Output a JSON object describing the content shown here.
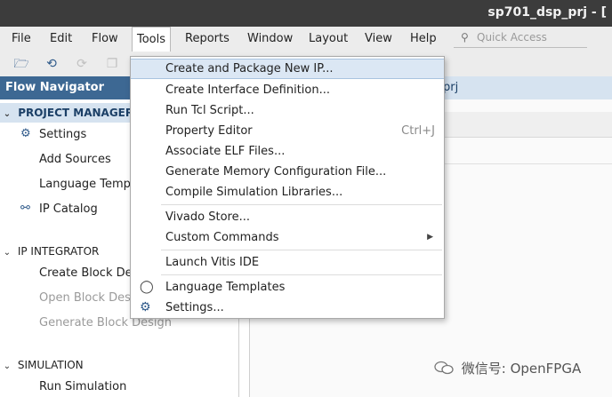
{
  "window": {
    "title": "sp701_dsp_prj - ["
  },
  "menubar": {
    "items": [
      "File",
      "Edit",
      "Flow",
      "Tools",
      "Reports",
      "Window",
      "Layout",
      "View",
      "Help"
    ],
    "active": "Tools"
  },
  "quick_access": {
    "placeholder": "Quick Access"
  },
  "flow_navigator": {
    "title": "Flow Navigator",
    "sections": [
      {
        "label": "PROJECT MANAGER",
        "items": [
          "Settings",
          "Add Sources",
          "Language Templates",
          "IP Catalog"
        ]
      },
      {
        "label": "IP INTEGRATOR",
        "items": [
          "Create Block Design",
          "Open Block Design",
          "Generate Block Design"
        ]
      },
      {
        "label": "SIMULATION",
        "items": [
          "Run Simulation"
        ]
      }
    ]
  },
  "project_header": {
    "text": "prj"
  },
  "tools_menu": {
    "items": [
      {
        "label": "Create and Package New IP..."
      },
      {
        "label": "Create Interface Definition..."
      },
      {
        "label": "Run Tcl Script..."
      },
      {
        "label": "Property Editor",
        "shortcut": "Ctrl+J"
      },
      {
        "label": "Associate ELF Files..."
      },
      {
        "label": "Generate Memory Configuration File..."
      },
      {
        "label": "Compile Simulation Libraries..."
      },
      {
        "label": "Vivado Store..."
      },
      {
        "label": "Custom Commands"
      },
      {
        "label": "Launch Vitis IDE"
      },
      {
        "label": "Language Templates"
      },
      {
        "label": "Settings..."
      }
    ]
  },
  "watermark": {
    "text": "微信号: OpenFPGA"
  },
  "colors": {
    "nav_header": "#3d6893",
    "selection": "#d6e3f0",
    "menu_highlight": "#dbe7f4"
  }
}
